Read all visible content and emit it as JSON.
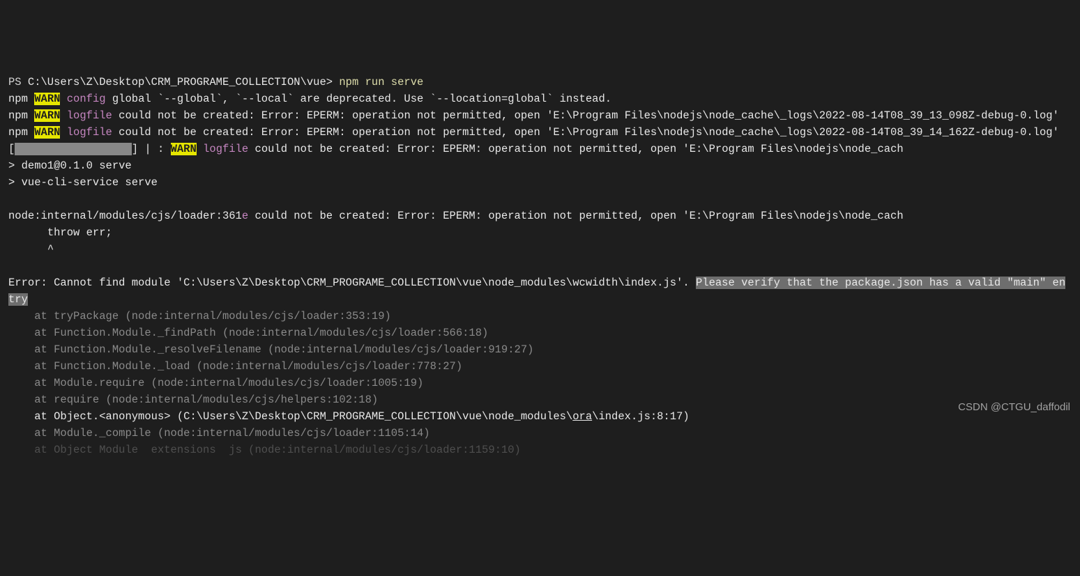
{
  "prompt": {
    "ps": "PS ",
    "path": "C:\\Users\\Z\\Desktop\\CRM_PROGRAME_COLLECTION\\vue>",
    "cmd": " npm run serve"
  },
  "lines": {
    "l1_a": "npm ",
    "l1_warn": "WARN",
    "l1_b": " ",
    "l1_config": "config",
    "l1_c": " global `--global`, `--local` are deprecated. Use `--location=global` instead.",
    "l2_a": "npm ",
    "l2_warn": "WARN",
    "l2_b": " ",
    "l2_logfile": "logfile",
    "l2_c": " could not be created: Error: EPERM: operation not permitted, open 'E:\\Program Files\\nodejs\\node_cache\\_logs\\2022-08-14T08_39_13_098Z-debug-0.log'",
    "l3_a": "npm ",
    "l3_warn": "WARN",
    "l3_b": " ",
    "l3_logfile": "logfile",
    "l3_c": " could not be created: Error: EPERM: operation not permitted, open 'E:\\Program Files\\nodejs\\node_cache\\_logs\\2022-08-14T08_39_14_162Z-debug-0.log'",
    "l4_a": "[",
    "l4_redact": "                  ",
    "l4_b": "] | : ",
    "l4_warn": "WARN",
    "l4_c": " ",
    "l4_logfile": "logfile",
    "l4_d": " could not be created: Error: EPERM: operation not permitted, open 'E:\\Program Files\\nodejs\\node_cach",
    "l5": "> demo1@0.1.0 serve",
    "l6": "> vue-cli-service serve",
    "blank": "",
    "l7_a": "node:internal/modules/cjs/loader:361",
    "l7_e": "e",
    "l7_b": " could not be created: Error: EPERM: operation not permitted, open 'E:\\Program Files\\nodejs\\node_cach",
    "l8": "      throw err;",
    "l9": "      ^",
    "err_a": "Error: Cannot find module 'C:\\Users\\Z\\Desktop\\CRM_PROGRAME_COLLECTION\\vue\\node_modules\\wcwidth\\index.js'. ",
    "err_b": "Please verify that the package.json has a valid \"main\" entry",
    "st1": "    at tryPackage (node:internal/modules/cjs/loader:353:19)",
    "st2": "    at Function.Module._findPath (node:internal/modules/cjs/loader:566:18)",
    "st3": "    at Function.Module._resolveFilename (node:internal/modules/cjs/loader:919:27)",
    "st4": "    at Function.Module._load (node:internal/modules/cjs/loader:778:27)",
    "st5": "    at Module.require (node:internal/modules/cjs/loader:1005:19)",
    "st6": "    at require (node:internal/modules/cjs/helpers:102:18)",
    "st7_a": "    at Object.<anonymous> (C:\\Users\\Z\\Desktop\\CRM_PROGRAME_COLLECTION\\vue\\node_modules\\",
    "st7_u": "ora",
    "st7_b": "\\index.js:8:17)",
    "st8": "    at Module._compile (node:internal/modules/cjs/loader:1105:14)",
    "st9": "    at Object Module  extensions  js (node:internal/modules/cjs/loader:1159:10)"
  },
  "watermark": "CSDN @CTGU_daffodil"
}
